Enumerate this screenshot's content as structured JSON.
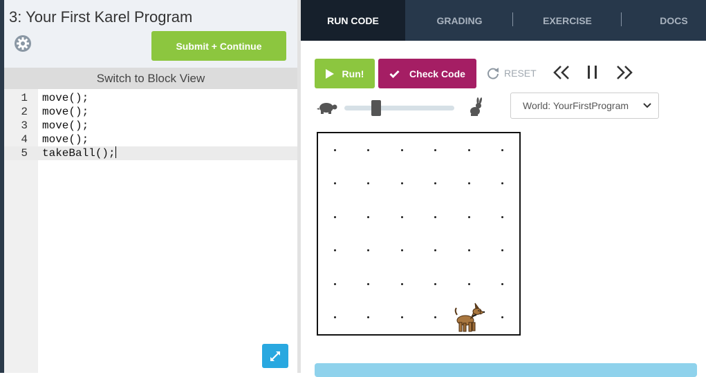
{
  "lesson": {
    "title": "3: Your First Karel Program",
    "submit_label": "Submit + Continue"
  },
  "editor": {
    "switch_label": "Switch to Block View",
    "lines": [
      {
        "num": "1",
        "code": "move();"
      },
      {
        "num": "2",
        "code": "move();"
      },
      {
        "num": "3",
        "code": "move();"
      },
      {
        "num": "4",
        "code": "move();"
      },
      {
        "num": "5",
        "code": "takeBall();"
      }
    ],
    "active_line": 5
  },
  "tabs": [
    {
      "label": "RUN CODE",
      "active": true
    },
    {
      "label": "GRADING",
      "active": false
    },
    {
      "label": "EXERCISE",
      "active": false
    },
    {
      "label": "DOCS",
      "active": false
    }
  ],
  "controls": {
    "run_label": "Run!",
    "check_label": "Check Code",
    "reset_label": "RESET",
    "speed_level": 0.27
  },
  "world_select": {
    "selected": "World: YourFirstProgram"
  },
  "world": {
    "cols": 6,
    "rows": 6,
    "karel": {
      "col": 5,
      "row": 1,
      "facing": "east"
    }
  },
  "colors": {
    "green": "#8cc63f",
    "magenta": "#a51e64",
    "tab_bar": "#27384b",
    "tab_active": "#16202c",
    "expand_blue": "#29a8e0"
  }
}
